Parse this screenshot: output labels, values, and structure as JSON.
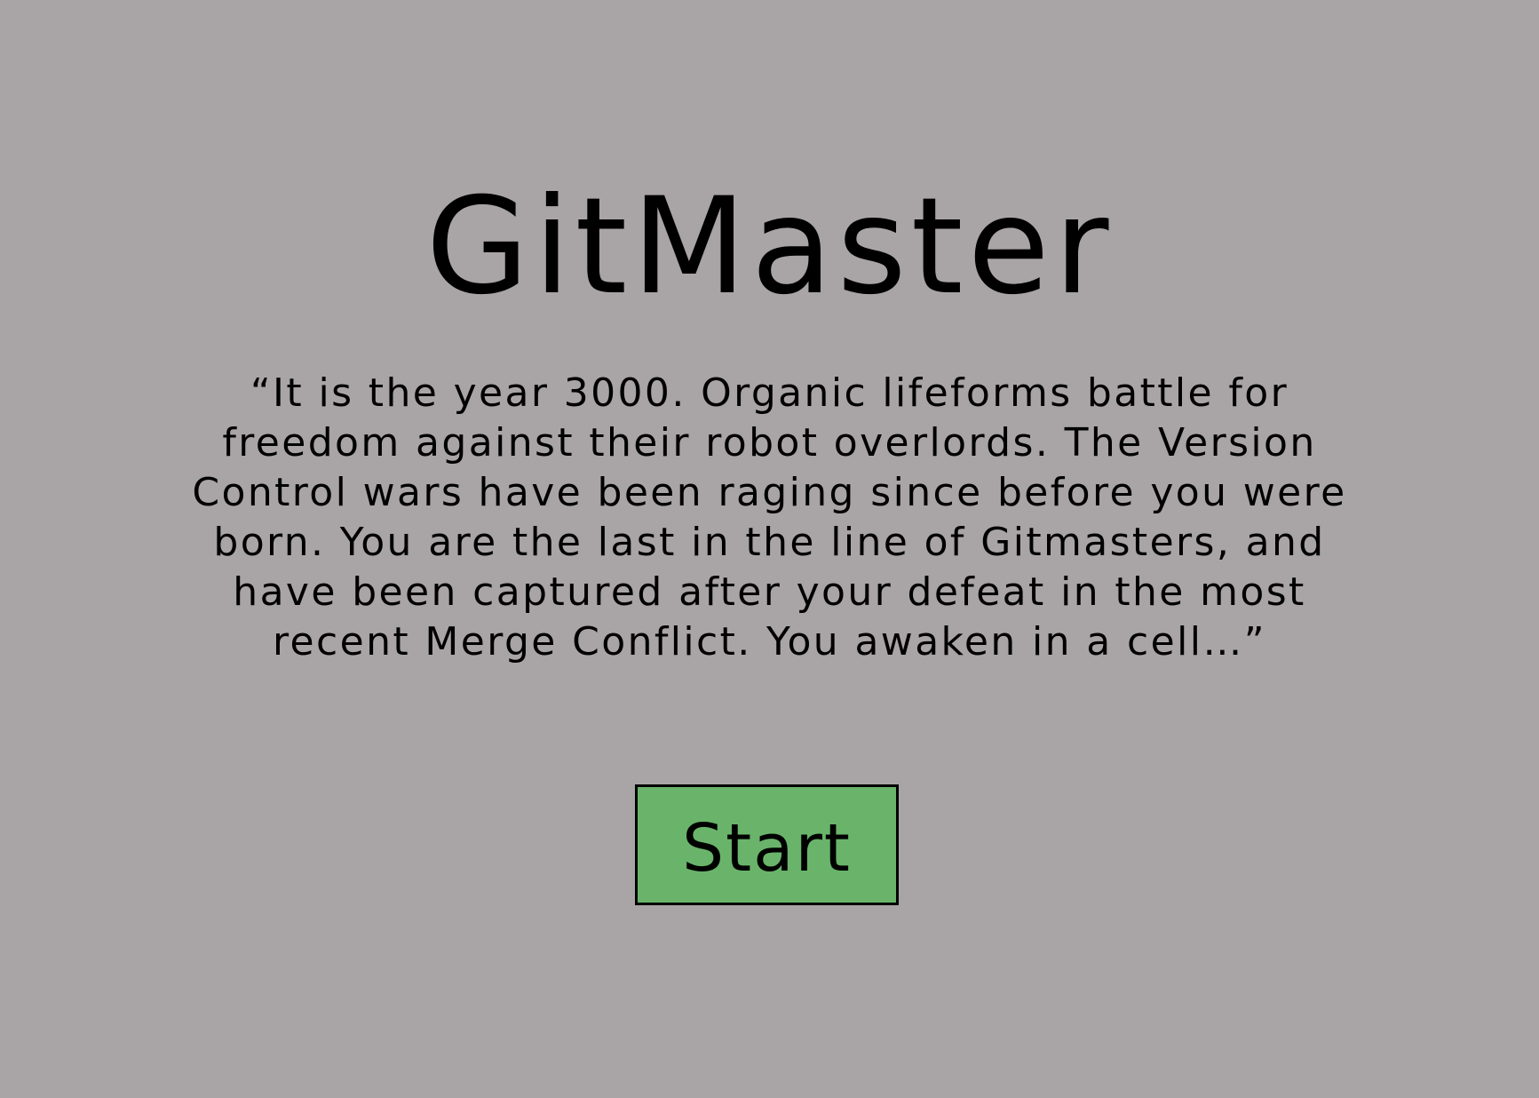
{
  "title": "GitMaster",
  "intro_text": "“It is the year 3000. Organic lifeforms battle for freedom against their robot overlords. The Version Control wars have been raging since before you were born. You are the last in the line of Gitmasters, and have been captured after your defeat in the most recent Merge Conflict. You awaken in a cell…”",
  "start_button": {
    "label": "Start"
  },
  "colors": {
    "background": "#a9a4a6",
    "button_fill": "#69b46a",
    "text": "#000000"
  }
}
